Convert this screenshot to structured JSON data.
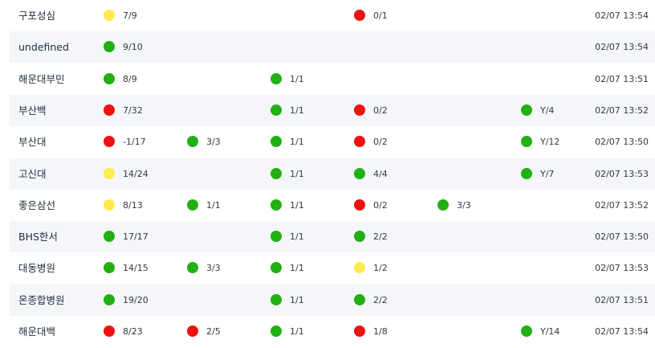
{
  "colors": {
    "green": "#22b014",
    "red": "#ee1111",
    "yellow": "#ffea4f",
    "stripe": "#f4f6f9"
  },
  "rows": [
    {
      "name": "구포성심",
      "cells": [
        {
          "col": 0,
          "status": "yellow",
          "value": "7/9"
        },
        {
          "col": 3,
          "status": "red",
          "value": "0/1"
        }
      ],
      "time": "02/07 13:54"
    },
    {
      "name": "undefined",
      "cells": [
        {
          "col": 0,
          "status": "green",
          "value": "9/10"
        }
      ],
      "time": "02/07 13:54"
    },
    {
      "name": "해운대부민",
      "cells": [
        {
          "col": 0,
          "status": "green",
          "value": "8/9"
        },
        {
          "col": 2,
          "status": "green",
          "value": "1/1"
        }
      ],
      "time": "02/07 13:51"
    },
    {
      "name": "부산백",
      "cells": [
        {
          "col": 0,
          "status": "red",
          "value": "7/32"
        },
        {
          "col": 2,
          "status": "green",
          "value": "1/1"
        },
        {
          "col": 3,
          "status": "red",
          "value": "0/2"
        },
        {
          "col": 5,
          "status": "green",
          "value": "Y/4"
        }
      ],
      "time": "02/07 13:52"
    },
    {
      "name": "부산대",
      "cells": [
        {
          "col": 0,
          "status": "red",
          "value": "-1/17"
        },
        {
          "col": 1,
          "status": "green",
          "value": "3/3"
        },
        {
          "col": 2,
          "status": "green",
          "value": "1/1"
        },
        {
          "col": 3,
          "status": "red",
          "value": "0/2"
        },
        {
          "col": 5,
          "status": "green",
          "value": "Y/12"
        }
      ],
      "time": "02/07 13:50"
    },
    {
      "name": "고신대",
      "cells": [
        {
          "col": 0,
          "status": "yellow",
          "value": "14/24"
        },
        {
          "col": 2,
          "status": "green",
          "value": "1/1"
        },
        {
          "col": 3,
          "status": "green",
          "value": "4/4"
        },
        {
          "col": 5,
          "status": "green",
          "value": "Y/7"
        }
      ],
      "time": "02/07 13:53"
    },
    {
      "name": "좋은삼선",
      "cells": [
        {
          "col": 0,
          "status": "yellow",
          "value": "8/13"
        },
        {
          "col": 1,
          "status": "green",
          "value": "1/1"
        },
        {
          "col": 2,
          "status": "green",
          "value": "1/1"
        },
        {
          "col": 3,
          "status": "red",
          "value": "0/2"
        },
        {
          "col": 4,
          "status": "green",
          "value": "3/3"
        }
      ],
      "time": "02/07 13:52"
    },
    {
      "name": "BHS한서",
      "cells": [
        {
          "col": 0,
          "status": "green",
          "value": "17/17"
        },
        {
          "col": 2,
          "status": "green",
          "value": "1/1"
        },
        {
          "col": 3,
          "status": "green",
          "value": "2/2"
        }
      ],
      "time": "02/07 13:50"
    },
    {
      "name": "대동병원",
      "cells": [
        {
          "col": 0,
          "status": "green",
          "value": "14/15"
        },
        {
          "col": 1,
          "status": "green",
          "value": "3/3"
        },
        {
          "col": 2,
          "status": "green",
          "value": "1/1"
        },
        {
          "col": 3,
          "status": "yellow",
          "value": "1/2"
        }
      ],
      "time": "02/07 13:53"
    },
    {
      "name": "온종합병원",
      "cells": [
        {
          "col": 0,
          "status": "green",
          "value": "19/20"
        },
        {
          "col": 2,
          "status": "green",
          "value": "1/1"
        },
        {
          "col": 3,
          "status": "green",
          "value": "2/2"
        }
      ],
      "time": "02/07 13:51"
    },
    {
      "name": "해운대백",
      "cells": [
        {
          "col": 0,
          "status": "red",
          "value": "8/23"
        },
        {
          "col": 1,
          "status": "red",
          "value": "2/5"
        },
        {
          "col": 2,
          "status": "green",
          "value": "1/1"
        },
        {
          "col": 3,
          "status": "red",
          "value": "1/8"
        },
        {
          "col": 5,
          "status": "green",
          "value": "Y/14"
        }
      ],
      "time": "02/07 13:54"
    }
  ]
}
